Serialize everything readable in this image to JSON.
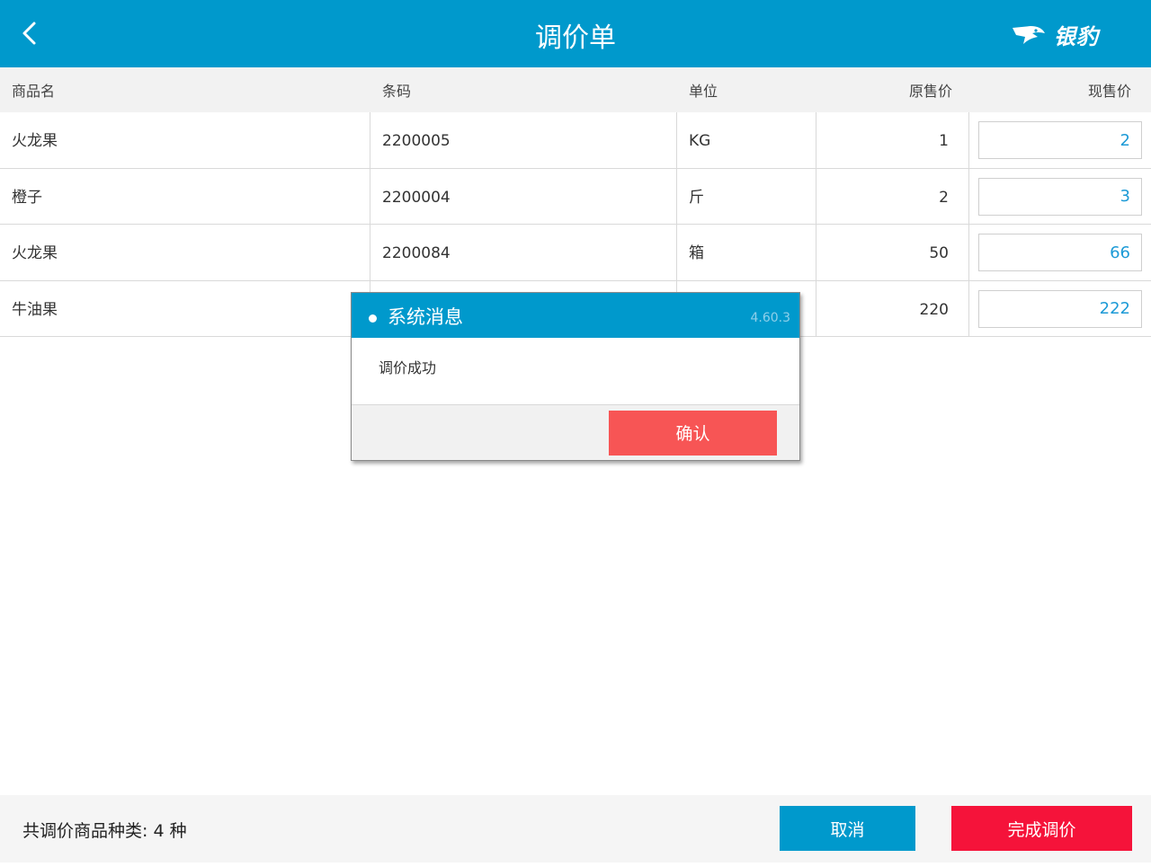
{
  "header": {
    "title": "调价单",
    "back_icon": "chevron-left-icon",
    "logo_text": "银豹"
  },
  "columns": {
    "name": "商品名",
    "code": "条码",
    "unit": "单位",
    "original_price": "原售价",
    "current_price": "现售价"
  },
  "rows": [
    {
      "name": "火龙果",
      "code": "2200005",
      "unit": "KG",
      "original_price": "1",
      "current_price": "2"
    },
    {
      "name": "橙子",
      "code": "2200004",
      "unit": "斤",
      "original_price": "2",
      "current_price": "3"
    },
    {
      "name": "火龙果",
      "code": "2200084",
      "unit": "箱",
      "original_price": "50",
      "current_price": "66"
    },
    {
      "name": "牛油果",
      "code": "",
      "unit": "",
      "original_price": "220",
      "current_price": "222"
    }
  ],
  "dialog": {
    "title": "系统消息",
    "version": "4.60.3",
    "message": "调价成功",
    "confirm_label": "确认"
  },
  "footer": {
    "summary": "共调价商品种类: 4 种",
    "cancel_label": "取消",
    "finish_label": "完成调价"
  },
  "colors": {
    "primary": "#0099cc",
    "confirm": "#f75555",
    "finish": "#f5133a",
    "price_text": "#1c9ad6"
  }
}
